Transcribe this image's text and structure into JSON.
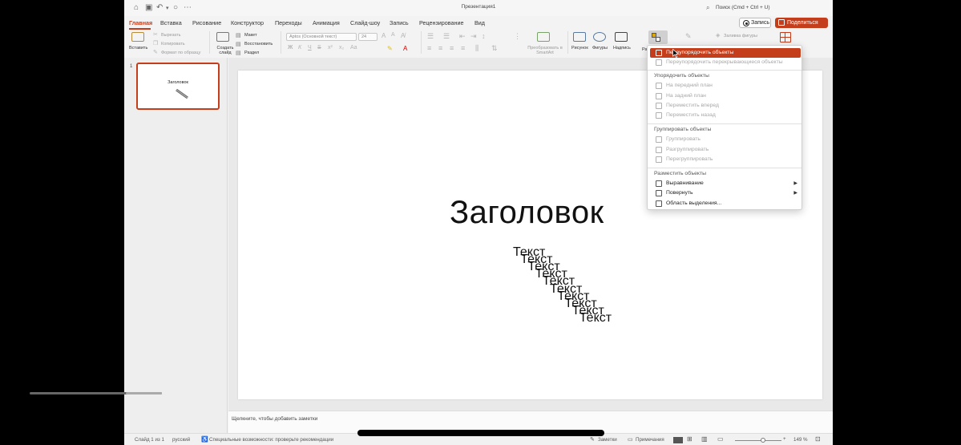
{
  "app": {
    "doc_title": "Презентация1",
    "search_placeholder": "Поиск (Cmd + Ctrl + U)"
  },
  "tabs": [
    "Главная",
    "Вставка",
    "Рисование",
    "Конструктор",
    "Переходы",
    "Анимация",
    "Слайд-шоу",
    "Запись",
    "Рецензирование",
    "Вид"
  ],
  "header_buttons": {
    "record": "Запись",
    "share": "Поделиться"
  },
  "ribbon": {
    "paste": "Вставить",
    "cut": "Вырезать",
    "copy": "Копировать",
    "format_painter": "Формат по образцу",
    "new_slide": "Создать слайд",
    "layout": "Макет",
    "reset": "Восстановить",
    "section": "Раздел",
    "font_name": "Aptos (Основной текст)",
    "font_size": "24",
    "convert_smartart": "Преобразовать в SmartArt",
    "picture": "Рисунок",
    "shapes": "Фигуры",
    "textbox": "Надпись",
    "arrange": "Ра",
    "shape_fill": "Заливка фигуры"
  },
  "thumbnails": {
    "number": "1",
    "title": "Заголовок"
  },
  "slide": {
    "title": "Заголовок",
    "texts": [
      "Текст",
      "Текст",
      "Текст",
      "Текст",
      "Текст",
      "Текст",
      "Текст",
      "Текст",
      "Текст",
      "Текст"
    ]
  },
  "notes_placeholder": "Щелкните, чтобы добавить заметки",
  "status": {
    "slide_counter": "Слайд 1 из 1",
    "language": "русский",
    "accessibility": "Специальные возможности: проверьте рекомендации",
    "notes": "Заметки",
    "comments": "Примечания",
    "zoom": "149 %"
  },
  "menu": {
    "reorder_objects": "Переупорядочить объекты",
    "reorder_overlapping": "Переупорядочить перекрывающиеся объекты",
    "order_header": "Упорядочить объекты",
    "bring_to_front": "На передний план",
    "send_to_back": "На задний план",
    "bring_forward": "Переместить вперед",
    "send_backward": "Переместить назад",
    "group_header": "Группировать объекты",
    "group": "Группировать",
    "ungroup": "Разгруппировать",
    "regroup": "Перегруппировать",
    "position_header": "Разместить объекты",
    "align": "Выравнивание",
    "rotate": "Повернуть",
    "selection_pane": "Область выделения..."
  },
  "colors": {
    "accent": "#c43e1c",
    "menu_highlight": "#c43e1c"
  }
}
